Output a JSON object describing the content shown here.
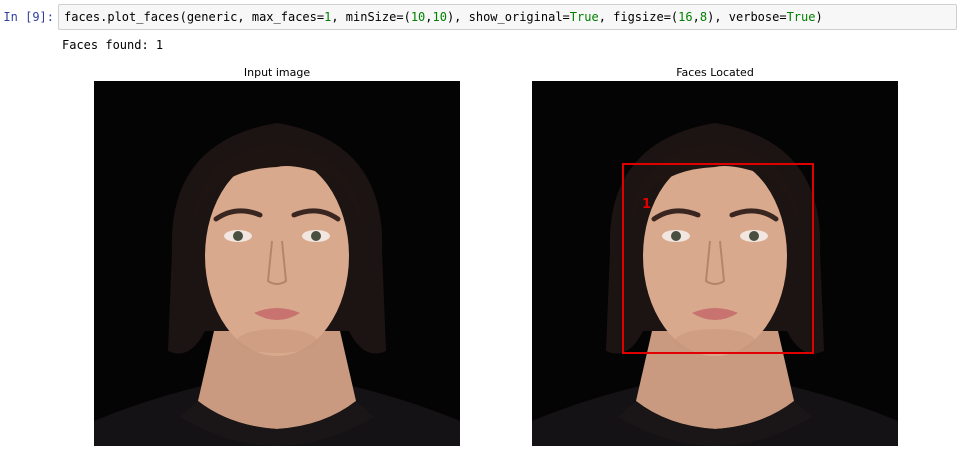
{
  "cell": {
    "prompt": "In [9]:",
    "code_parts": {
      "p1": "faces.plot_faces(generic, max_faces=",
      "n1": "1",
      "p2": ", minSize=(",
      "n2": "10",
      "p3": ",",
      "n3": "10",
      "p4": "), show_original=",
      "k1": "True",
      "p5": ", figsize=(",
      "n4": "16",
      "p6": ",",
      "n5": "8",
      "p7": "), verbose=",
      "k2": "True",
      "p8": ")"
    },
    "output_text": "Faces found: 1"
  },
  "plots": {
    "left_title": "Input image",
    "right_title": "Faces Located",
    "face_label": "1"
  },
  "colors": {
    "keyword_green": "#008000",
    "box_red": "#e00000",
    "prompt_blue": "#303f9f"
  }
}
